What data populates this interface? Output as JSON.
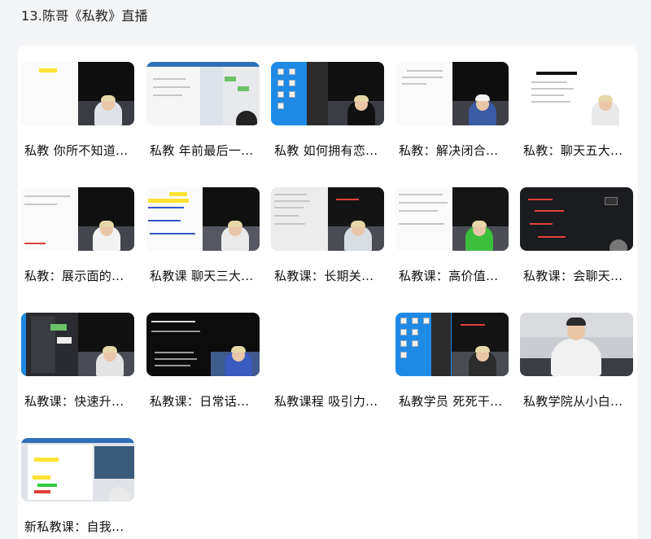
{
  "page": {
    "title": "13.陈哥《私教》直播"
  },
  "videos": [
    {
      "title": "私教 你所不知道..."
    },
    {
      "title": "私教 年前最后一..."
    },
    {
      "title": "私教 如何拥有恋..."
    },
    {
      "title": "私教：解决闭合..."
    },
    {
      "title": "私教：聊天五大..."
    },
    {
      "title": "私教：展示面的..."
    },
    {
      "title": "私教课 聊天三大..."
    },
    {
      "title": "私教课：长期关..."
    },
    {
      "title": "私教课：高价值..."
    },
    {
      "title": "私教课：会聊天..."
    },
    {
      "title": "私教课：快速升..."
    },
    {
      "title": "私教课：日常话..."
    },
    {
      "title": "私教课程 吸引力..."
    },
    {
      "title": "私教学员 死死干..."
    },
    {
      "title": "私教学院从小白..."
    },
    {
      "title": "新私教课：自我..."
    }
  ]
}
